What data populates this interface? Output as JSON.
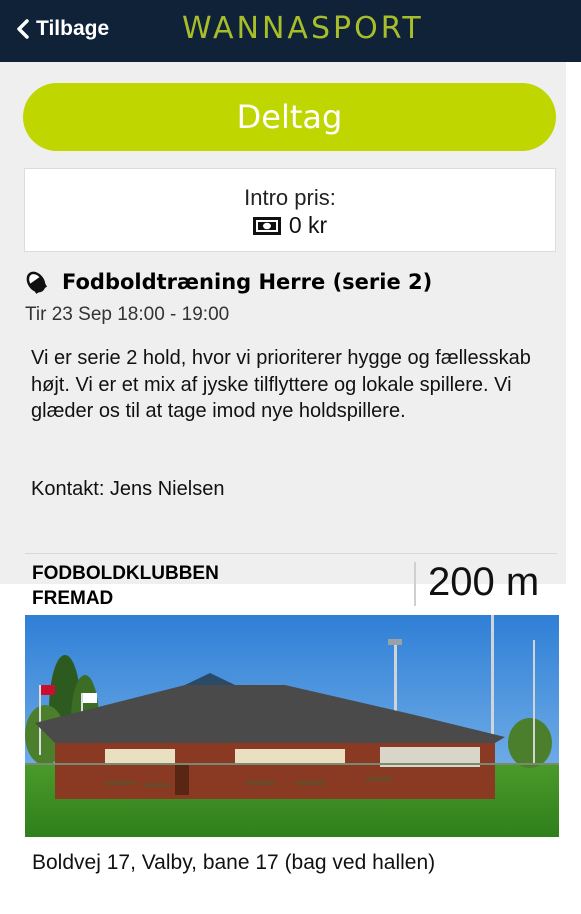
{
  "header": {
    "back_label": "Tilbage",
    "logo_text": "WANNASPORT"
  },
  "join_button": {
    "label": "Deltag"
  },
  "price": {
    "label": "Intro pris:",
    "value": "0 kr"
  },
  "event": {
    "title": "Fodboldtræning Herre (serie 2)",
    "datetime": "Tir 23 Sep 18:00 - 19:00",
    "description": "Vi er serie 2 hold, hvor vi prioriterer hygge og fællesskab højt. Vi er et mix af jyske tilflyttere og lokale spillere. Vi glæder os til at tage imod nye holdspillere.",
    "contact": "Kontakt: Jens Nielsen"
  },
  "venue": {
    "club_name": "FODBOLDKLUBBEN FREMAD",
    "distance": "200 m",
    "address": "Boldvej 17, Valby, bane 17 (bag ved hallen)"
  },
  "colors": {
    "header_bg": "#0f2238",
    "accent": "#bfd600",
    "logo": "#a7bd2a",
    "page_bg": "#efefef"
  },
  "icons": {
    "back": "chevron-left-icon",
    "price": "banknote-icon",
    "sport": "football-icon"
  }
}
